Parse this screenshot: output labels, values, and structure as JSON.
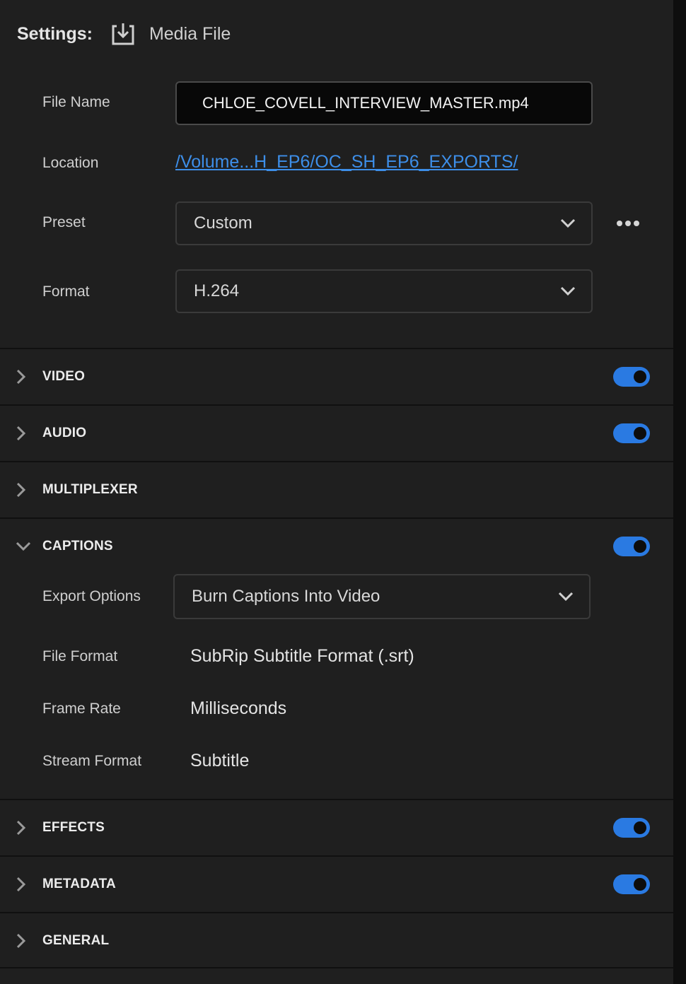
{
  "header": {
    "settings_label": "Settings:",
    "media_label": "Media File"
  },
  "file_name": {
    "label": "File Name",
    "value": "CHLOE_COVELL_INTERVIEW_MASTER.mp4"
  },
  "location": {
    "label": "Location",
    "value": "/Volume...H_EP6/OC_SH_EP6_EXPORTS/"
  },
  "preset": {
    "label": "Preset",
    "value": "Custom"
  },
  "format": {
    "label": "Format",
    "value": "H.264"
  },
  "sections": {
    "video": {
      "title": "VIDEO",
      "enabled": true
    },
    "audio": {
      "title": "AUDIO",
      "enabled": true
    },
    "multiplexer": {
      "title": "MULTIPLEXER"
    },
    "captions": {
      "title": "CAPTIONS",
      "enabled": true,
      "expanded": true
    },
    "effects": {
      "title": "EFFECTS",
      "enabled": true
    },
    "metadata": {
      "title": "METADATA",
      "enabled": true
    },
    "general": {
      "title": "GENERAL"
    }
  },
  "captions": {
    "export_options": {
      "label": "Export Options",
      "value": "Burn Captions Into Video"
    },
    "file_format": {
      "label": "File Format",
      "value": "SubRip Subtitle Format (.srt)"
    },
    "frame_rate": {
      "label": "Frame Rate",
      "value": "Milliseconds"
    },
    "stream_format": {
      "label": "Stream Format",
      "value": "Subtitle"
    }
  },
  "colors": {
    "accent": "#2a7ae2",
    "link": "#3d8ee8",
    "panel": "#1f1f1f"
  },
  "icons": {
    "export": "export-icon",
    "more": "more-icon",
    "chevron_right": "chevron-right-icon",
    "chevron_down": "chevron-down-icon"
  }
}
